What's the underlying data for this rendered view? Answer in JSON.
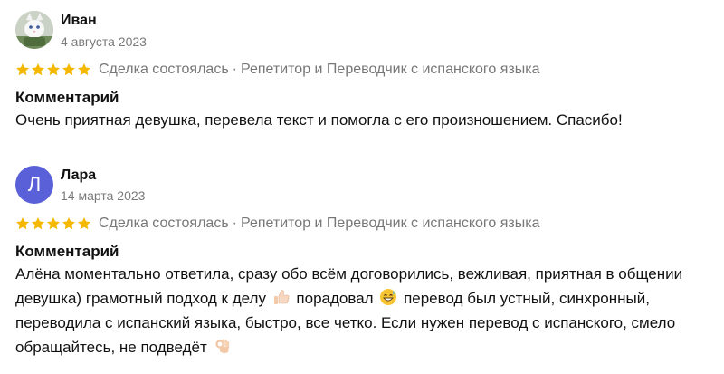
{
  "reviews": [
    {
      "author": "Иван",
      "date": "4 августа 2023",
      "avatar_type": "photo",
      "rating": 5,
      "deal_status": "Сделка состоялась",
      "separator": "·",
      "service": "Репетитор и Переводчик с испанского языка",
      "comment_heading": "Комментарий",
      "comment": "Очень приятная девушка, перевела текст и помогла с его произношением. Спасибо!"
    },
    {
      "author": "Лара",
      "date": "14 марта 2023",
      "avatar_type": "letter",
      "avatar_letter": "Л",
      "rating": 5,
      "deal_status": "Сделка состоялась",
      "separator": "·",
      "service": "Репетитор и Переводчик с испанского языка",
      "comment_heading": "Комментарий",
      "comment_parts": [
        "Алёна моментально ответила, сразу обо всём договорились, вежливая, приятная в общении девушка) грамотный подход к делу",
        "порадовал",
        "перевод был устный, синхронный, переводила с испанский языка, быстро, все четко. Если нужен перевод с испанского, смело обращайтесь, не подведёт"
      ],
      "emojis": [
        "thumbs-up-icon",
        "grinning-sweat-icon",
        "ok-hand-icon"
      ]
    }
  ],
  "colors": {
    "star": "#f5b800",
    "avatar_letter_bg": "#5a60d8",
    "meta_text": "#777777",
    "date_text": "#7a7a7a"
  }
}
